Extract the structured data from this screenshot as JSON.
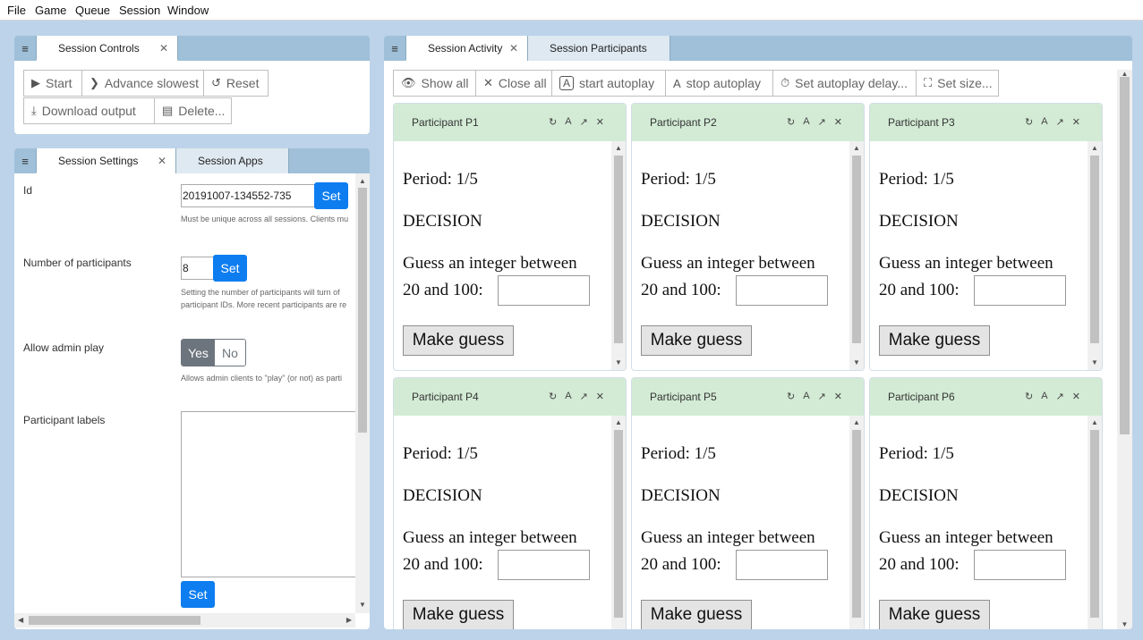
{
  "menu": [
    "File",
    "Game",
    "Queue",
    "Session",
    "Window"
  ],
  "session_controls": {
    "tab_label": "Session Controls",
    "buttons": {
      "start": "Start",
      "advance_slowest": "Advance slowest",
      "reset": "Reset",
      "download_output": "Download output",
      "delete": "Delete..."
    }
  },
  "settings": {
    "tabs": [
      "Session Settings",
      "Session Apps"
    ],
    "id_label": "Id",
    "id_value": "20191007-134552-735",
    "id_help": "Must be unique across all sessions. Clients mu",
    "participants_label": "Number of participants",
    "participants_value": "8",
    "participants_help_1": "Setting the number of participants will turn of",
    "participants_help_2": "participant IDs. More recent participants are re",
    "admin_play_label": "Allow admin play",
    "admin_yes": "Yes",
    "admin_no": "No",
    "admin_selected": "Yes",
    "admin_help": "Allows admin clients to \"play\" (or not) as parti",
    "labels_label": "Participant labels",
    "set_label": "Set"
  },
  "activity": {
    "tabs": [
      "Session Activity",
      "Session Participants"
    ],
    "toolbar": {
      "show_all": "Show all",
      "close_all": "Close all",
      "start_autoplay": "start autoplay",
      "stop_autoplay": "stop autoplay",
      "set_autoplay_delay": "Set autoplay delay...",
      "set_size": "Set size..."
    },
    "participants": [
      {
        "title": "Participant P1"
      },
      {
        "title": "Participant P2"
      },
      {
        "title": "Participant P3"
      },
      {
        "title": "Participant P4"
      },
      {
        "title": "Participant P5"
      },
      {
        "title": "Participant P6"
      }
    ],
    "card": {
      "period": "Period: 1/5",
      "decision": "DECISION",
      "guess_line1": "Guess an integer between",
      "guess_line2": "20 and 100:",
      "make_guess": "Make guess"
    }
  },
  "colors": {
    "background": "#bdd3ea",
    "tab_bar": "#9fc0d8",
    "card_header": "#d3ebd5",
    "primary_button": "#0d7df0",
    "toggle_selected": "#6c757d"
  }
}
